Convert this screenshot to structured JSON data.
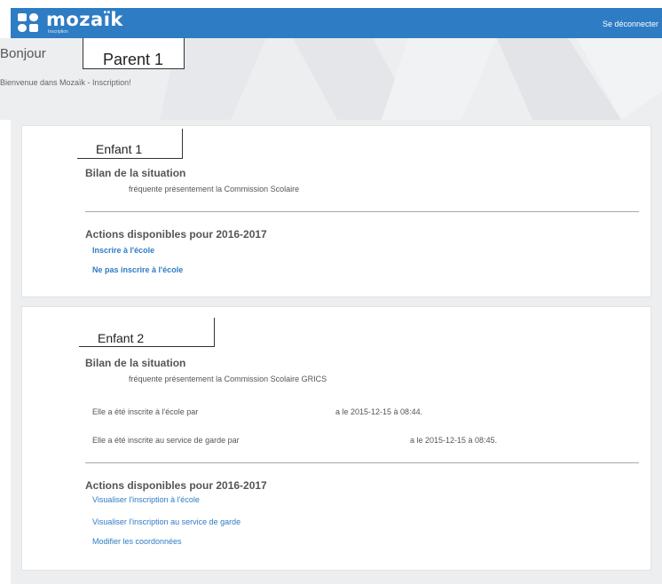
{
  "header": {
    "logo_text": "mozaïk",
    "logo_subtitle": "Inscription",
    "logout_label": "Se déconnecter",
    "brand_color": "#2e7cc3"
  },
  "greeting": {
    "hello": "Bonjour",
    "name": "Parent 1",
    "welcome": "Bienvenue dans Mozaïk - Inscription!"
  },
  "children": [
    {
      "name": "Enfant 1",
      "status_title": "Bilan de la situation",
      "status_lines": [
        "fréquente présentement la Commission Scolaire"
      ],
      "actions_title": "Actions disponibles pour 2016-2017",
      "actions": [
        "Inscrire à l'école",
        "Ne pas inscrire à l'école"
      ]
    },
    {
      "name": "Enfant 2",
      "status_title": "Bilan de la situation",
      "status_lines": [
        "fréquente présentement la Commission Scolaire GRICS",
        "Elle a été inscrite à l'école par",
        "a le 2015-12-15 à 08:44.",
        "Elle a été inscrite au service de garde par",
        "a le 2015-12-15 à 08:45."
      ],
      "actions_title": "Actions disponibles pour 2016-2017",
      "actions": [
        "Visualiser l'inscription à l'école",
        "Visualiser l'inscription au service de garde",
        "Modifier les coordonnées"
      ]
    }
  ]
}
